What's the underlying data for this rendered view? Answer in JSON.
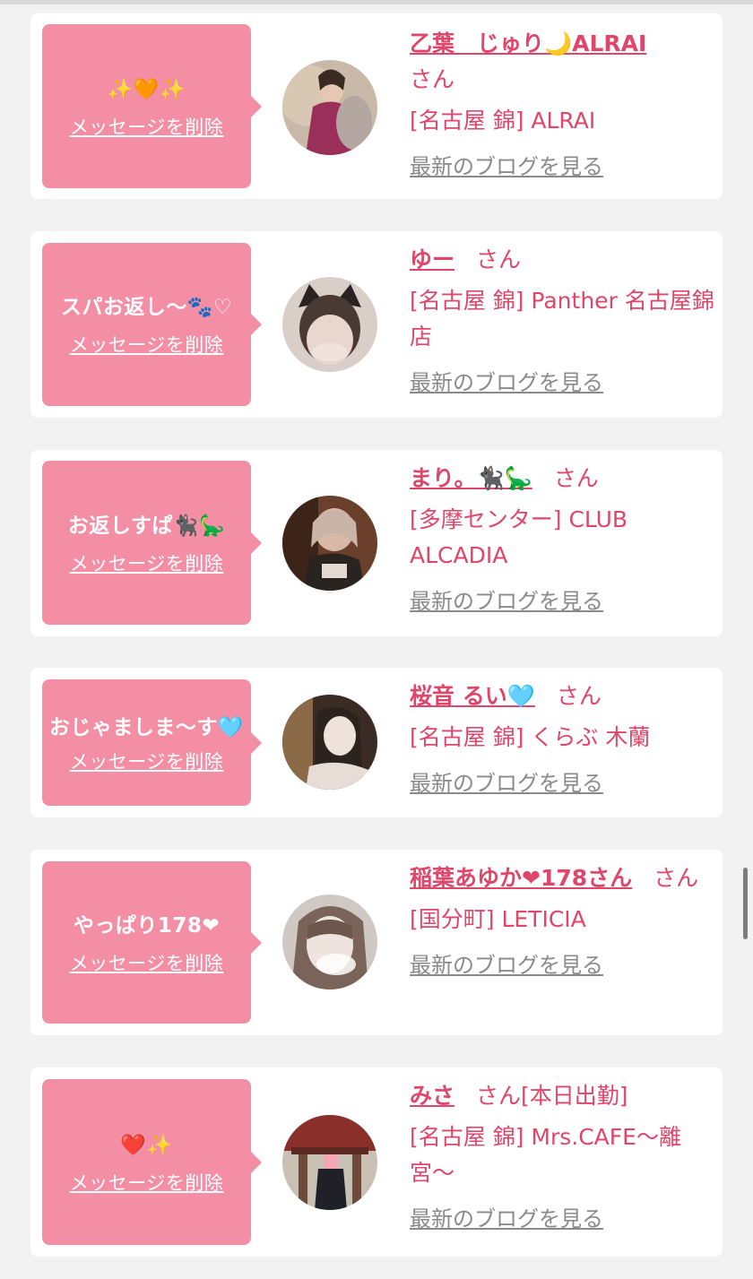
{
  "delete_label": "メッセージを削除",
  "blog_label": "最新のブログを見る",
  "san_label": "さん",
  "items": [
    {
      "message": "✨🧡✨",
      "name": "乙葉　じゅり🌙ALRAI",
      "suffix": "",
      "shop": "[名古屋 錦] ALRAI",
      "avatar_color": "#b08a86"
    },
    {
      "message": "スパお返し〜🐾♡",
      "name": "ゆー",
      "suffix": "",
      "shop": "[名古屋 錦] Panther 名古屋錦店",
      "avatar_color": "#d8ccc6"
    },
    {
      "message": "お返しすぱ🐈‍⬛🦕",
      "name": "まり。🐈‍⬛🦕",
      "suffix": "",
      "shop": "[多摩センター] CLUB ALCADIA",
      "avatar_color": "#8a5a42"
    },
    {
      "message": "おじゃましま〜す🩵",
      "name": "桜音 るい🩵",
      "suffix": "",
      "shop": "[名古屋 錦] くらぶ 木蘭",
      "avatar_color": "#6f5a4e"
    },
    {
      "message": "やっぱり178❤",
      "name": "稲葉あゆか❤178さん",
      "suffix": "",
      "shop": "[国分町] LETICIA",
      "avatar_color": "#a0958e"
    },
    {
      "message": "❤️✨",
      "name": "みさ",
      "suffix": "[本日出勤]",
      "shop": "[名古屋 錦] Mrs.CAFE〜離宮〜",
      "avatar_color": "#5d4a40"
    }
  ]
}
